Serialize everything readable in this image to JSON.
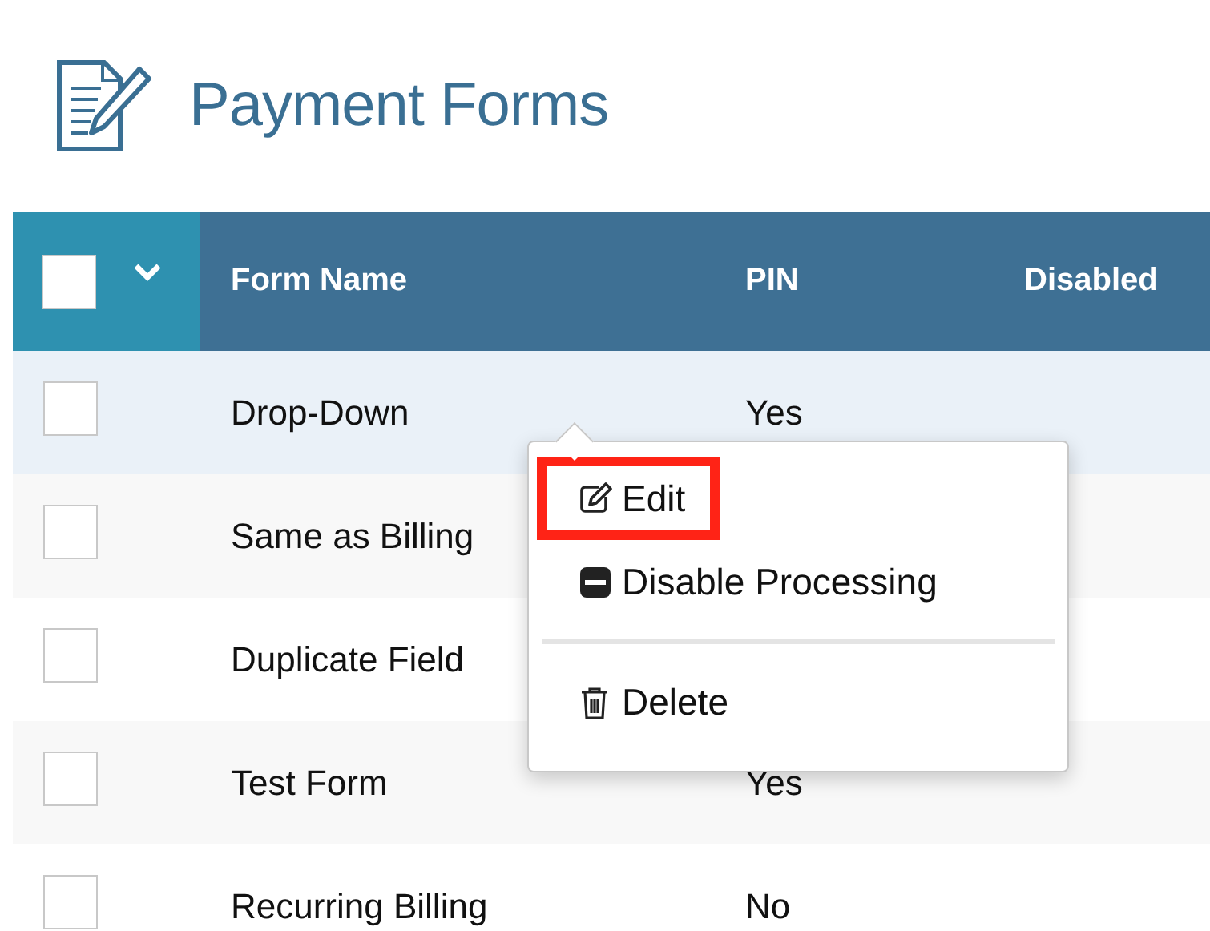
{
  "page": {
    "title": "Payment Forms"
  },
  "table": {
    "select_all": {
      "checked": false
    },
    "columns": [
      "Form Name",
      "PIN",
      "Disabled"
    ],
    "rows": [
      {
        "name": "Drop-Down",
        "pin": "Yes",
        "checked": false,
        "selected": true
      },
      {
        "name": "Same as Billing",
        "checked": false,
        "selected": false
      },
      {
        "name": "Duplicate Field",
        "checked": false,
        "selected": false
      },
      {
        "name": "Test Form",
        "pin": "Yes",
        "checked": false,
        "selected": false
      },
      {
        "name": "Recurring Billing",
        "pin": "No",
        "checked": false,
        "selected": false
      }
    ]
  },
  "context_menu": {
    "groups": [
      [
        {
          "label": "Edit",
          "kind": "edit",
          "highlighted": true
        },
        {
          "label": "Disable Processing",
          "kind": "disable",
          "highlighted": false
        }
      ],
      [
        {
          "label": "Delete",
          "kind": "delete",
          "highlighted": false
        }
      ]
    ]
  }
}
